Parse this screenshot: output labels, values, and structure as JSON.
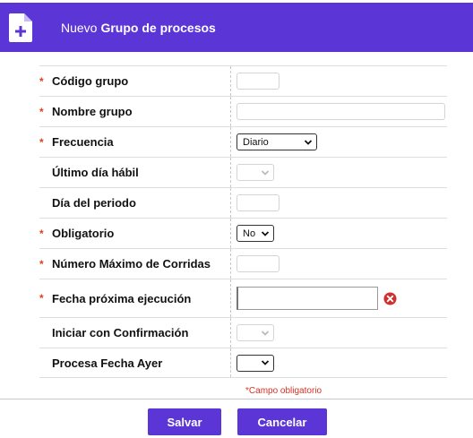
{
  "header": {
    "title_prefix": "Nuevo",
    "title_main": "Grupo de procesos",
    "icon": "add-document-icon",
    "color": "#5b35d5"
  },
  "required_marker": "*",
  "fields": [
    {
      "label": "Código grupo",
      "required": true,
      "control": "text",
      "value": ""
    },
    {
      "label": "Nombre grupo",
      "required": true,
      "control": "text",
      "value": ""
    },
    {
      "label": "Frecuencia",
      "required": true,
      "control": "select",
      "value": "Diario"
    },
    {
      "label": "Último día hábil",
      "required": false,
      "control": "select-disabled",
      "value": ""
    },
    {
      "label": "Día del periodo",
      "required": false,
      "control": "text",
      "value": ""
    },
    {
      "label": "Obligatorio",
      "required": true,
      "control": "select",
      "value": "No"
    },
    {
      "label": "Número Máximo de Corridas",
      "required": true,
      "control": "text",
      "value": ""
    },
    {
      "label": "Fecha próxima ejecución",
      "required": true,
      "control": "date",
      "value": ""
    },
    {
      "label": "Iniciar con Confirmación",
      "required": false,
      "control": "select-disabled",
      "value": ""
    },
    {
      "label": "Procesa Fecha Ayer",
      "required": false,
      "control": "select",
      "value": ""
    }
  ],
  "footnote": "Campo obligatorio",
  "buttons": {
    "save": "Salvar",
    "cancel": "Cancelar"
  },
  "colors": {
    "accent": "#5b35d5",
    "required": "#e04020",
    "clear_icon": "#d03030"
  }
}
